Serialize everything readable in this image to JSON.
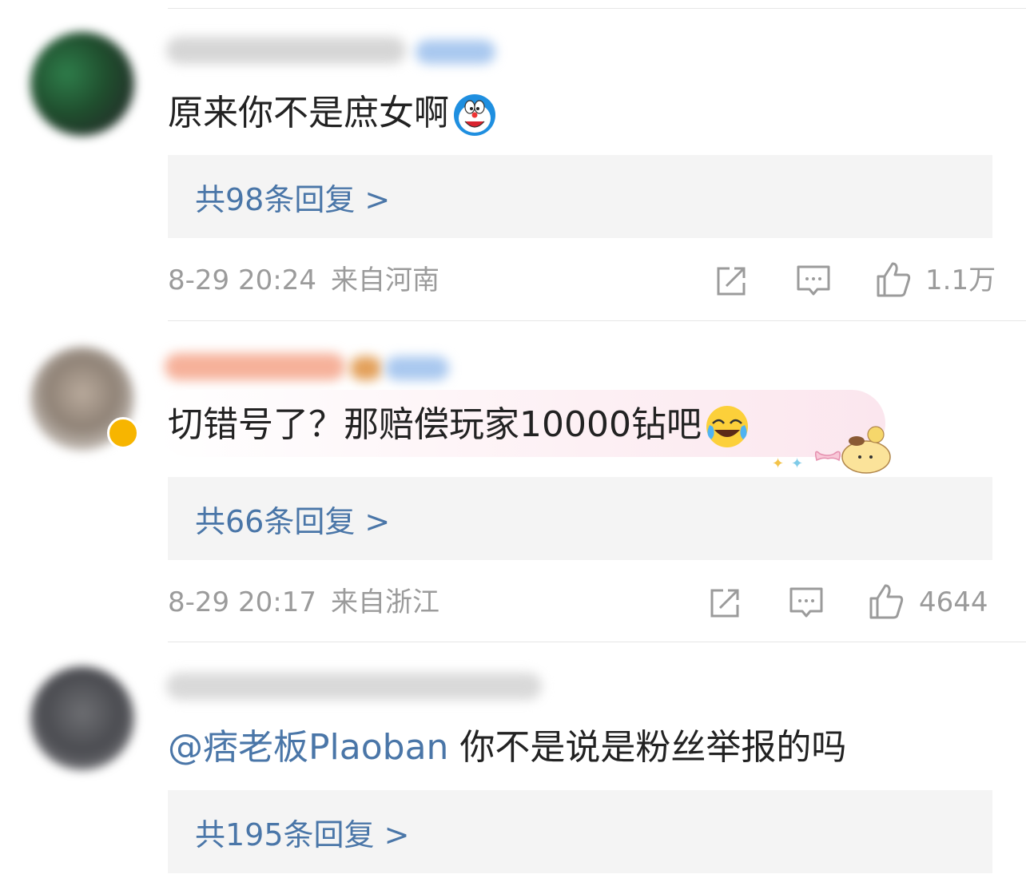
{
  "comments": [
    {
      "text": "原来你不是庶女啊",
      "emoji": "doraemon-emoji",
      "reply_label": "共98条回复 >",
      "time": "8-29 20:24",
      "location": "来自河南",
      "likes": "1.1万"
    },
    {
      "text": "切错号了？那赔偿玩家10000钻吧",
      "emoji": "laugh-cry-emoji",
      "reply_label": "共66条回复 >",
      "time": "8-29 20:17",
      "location": "来自浙江",
      "likes": "4644"
    },
    {
      "mention": "@痞老板Plaoban",
      "text": " 你不是说是粉丝举报的吗",
      "reply_label": "共195条回复 >"
    }
  ],
  "icons": {
    "share": "share-icon",
    "comment": "comment-icon",
    "like": "thumbs-up-icon"
  },
  "colors": {
    "link": "#4a76a8",
    "meta": "#9b9b9b",
    "reply_bg": "#f4f4f4"
  }
}
